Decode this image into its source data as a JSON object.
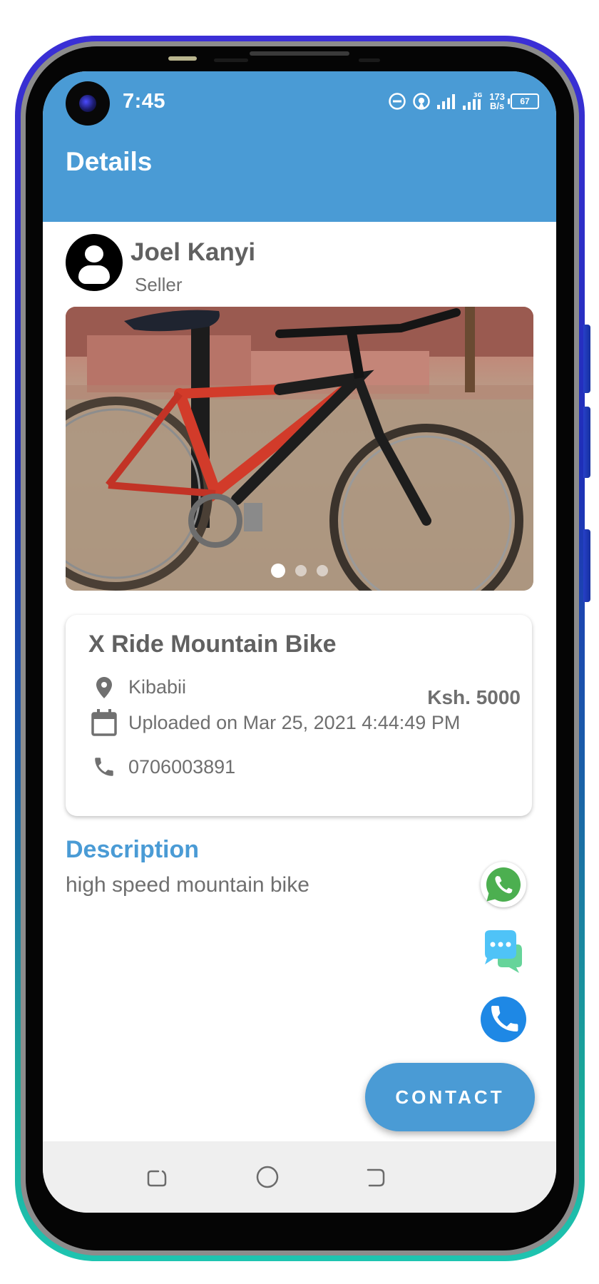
{
  "status_bar": {
    "time": "7:45",
    "net_speed_value": "173",
    "net_speed_unit": "B/s",
    "battery": "67",
    "icons": [
      "do-not-disturb-icon",
      "hotspot-icon",
      "signal-icon",
      "signal-3g-icon",
      "battery-icon"
    ]
  },
  "app_bar": {
    "title": "Details"
  },
  "seller": {
    "name": "Joel Kanyi",
    "role": "Seller"
  },
  "gallery": {
    "image_count": 3,
    "active_index": 0,
    "subject": "red and black mountain bike"
  },
  "listing": {
    "title": "X Ride Mountain Bike",
    "location": "Kibabii",
    "price": "Ksh. 5000",
    "uploaded": "Uploaded on Mar 25, 2021 4:44:49 PM",
    "phone": "0706003891"
  },
  "description": {
    "heading": "Description",
    "text": "high speed mountain bike"
  },
  "actions": {
    "contact_label": "CONTACT",
    "quick_icons": [
      "whatsapp-icon",
      "chat-icon",
      "call-icon"
    ]
  },
  "colors": {
    "primary": "#4a9bd5",
    "text": "#6f6f6f",
    "call": "#1e88e5",
    "whatsapp": "#4caf50"
  }
}
